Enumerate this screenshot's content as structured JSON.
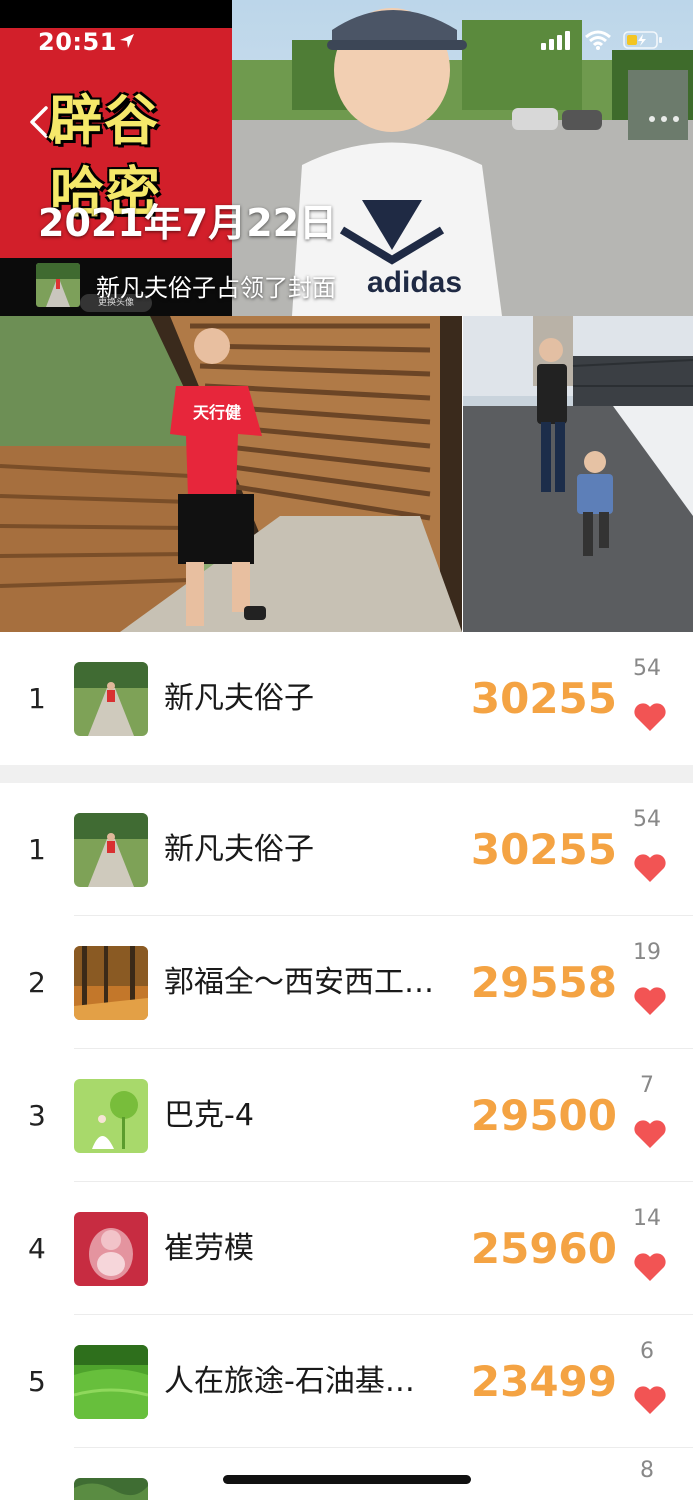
{
  "status_bar": {
    "time": "20:51"
  },
  "cover": {
    "title_line1": "辟谷",
    "title_line2": "哈密",
    "date": "2021年7月22日",
    "cover_note": "新凡夫俗子占领了封面",
    "avatar_hint": "更换头像"
  },
  "my_rank": {
    "rank": "1",
    "name": "新凡夫俗子",
    "steps": "30255",
    "likes": "54"
  },
  "ranking": [
    {
      "rank": "1",
      "name": "新凡夫俗子",
      "steps": "30255",
      "likes": "54"
    },
    {
      "rank": "2",
      "name": "郭福全～西安西工…",
      "steps": "29558",
      "likes": "19"
    },
    {
      "rank": "3",
      "name": "巴克-4",
      "steps": "29500",
      "likes": "7"
    },
    {
      "rank": "4",
      "name": "崔劳模",
      "steps": "25960",
      "likes": "14"
    },
    {
      "rank": "5",
      "name": "人在旅途-石油基…",
      "steps": "23499",
      "likes": "6"
    },
    {
      "rank": "",
      "name": "",
      "steps": "",
      "likes": "8"
    }
  ],
  "colors": {
    "steps": "#f4a343",
    "heart": "#f25454",
    "cover_red": "#d21f2a",
    "title_yellow": "#f5e86a"
  }
}
